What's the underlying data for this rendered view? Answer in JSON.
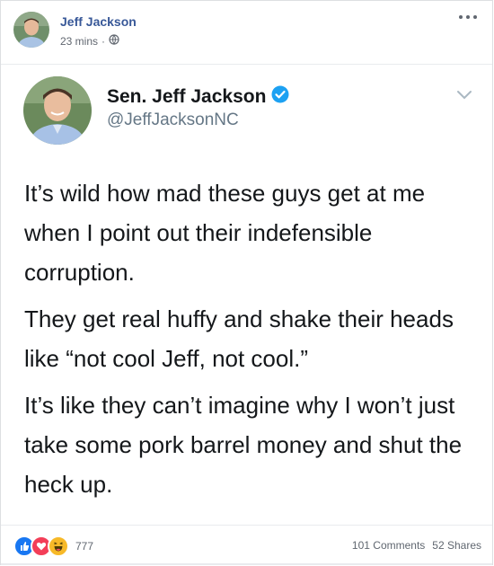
{
  "post": {
    "author": "Jeff Jackson",
    "time": "23 mins",
    "separator": "·",
    "privacy_icon": "globe-icon",
    "more_icon": "more-options-icon"
  },
  "tweet": {
    "name": "Sen. Jeff Jackson",
    "verified_icon": "verified-badge-icon",
    "handle": "@JeffJacksonNC",
    "paragraphs": [
      "It’s wild how mad these guys get at me when I point out their indefensible corruption.",
      "They get real huffy and shake their heads like “not cool Jeff, not cool.”",
      "It’s like they can’t imagine why I won’t just take some pork barrel money and shut the heck up."
    ],
    "accent": "#1da1f2"
  },
  "footer": {
    "reaction_icons": [
      "like-icon",
      "love-icon",
      "haha-icon"
    ],
    "reaction_count": "777",
    "comments": "101 Comments",
    "shares": "52 Shares"
  },
  "colors": {
    "fb_link": "#385898",
    "like": "#1877f2",
    "love": "#f33e58",
    "haha": "#f7b928"
  }
}
